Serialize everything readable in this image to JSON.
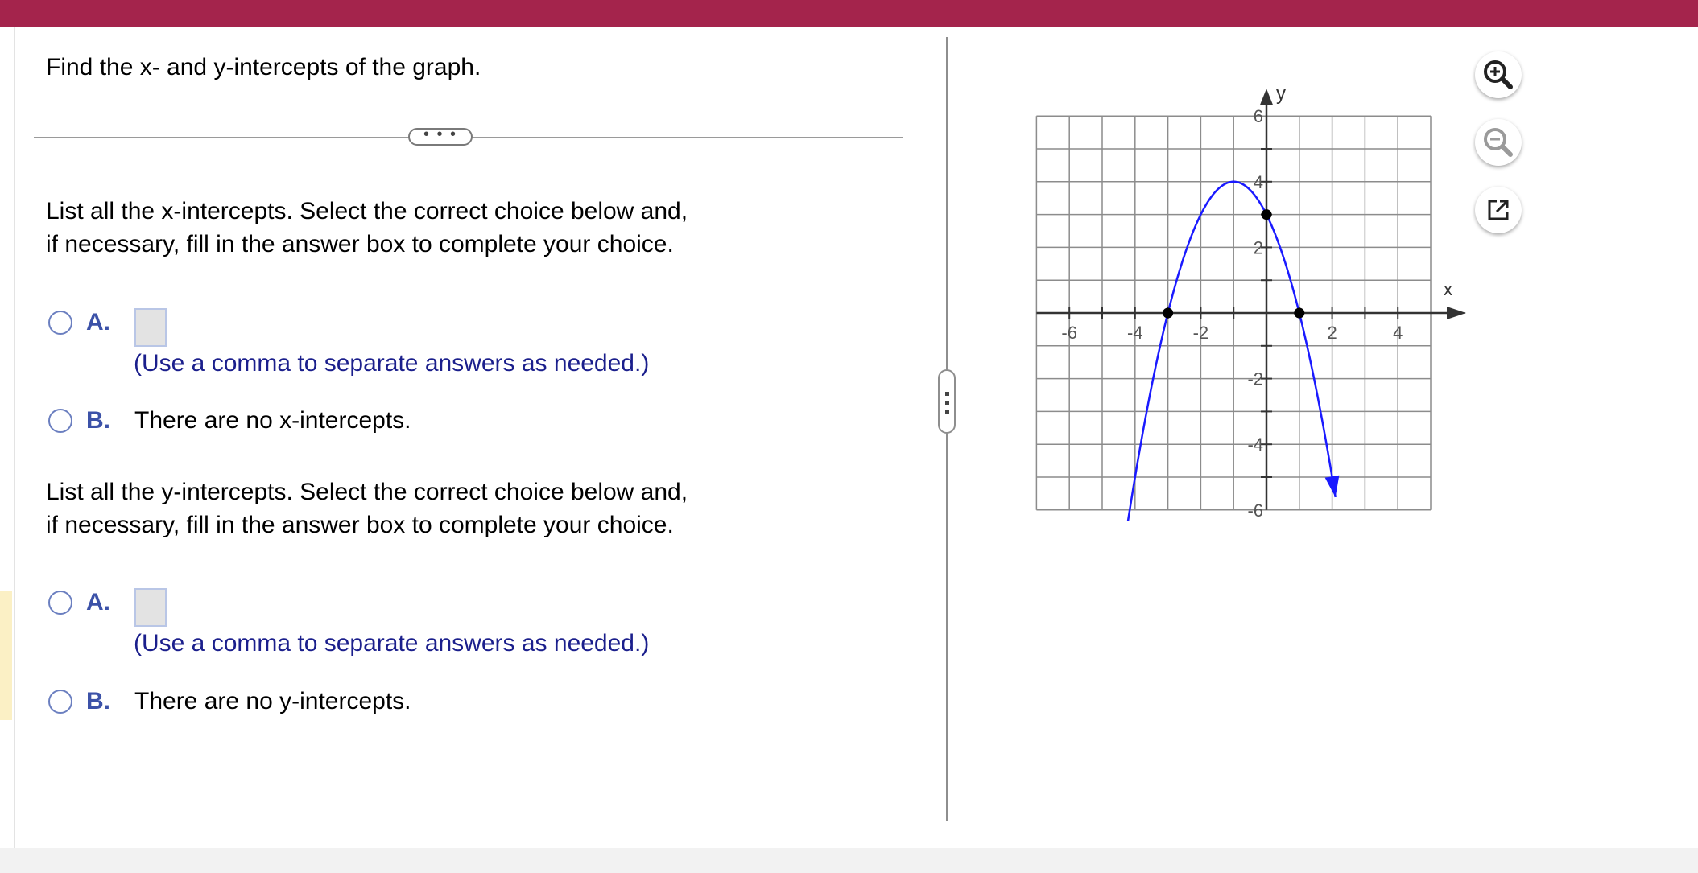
{
  "colors": {
    "header_bar": "#a4244c",
    "accent": "#3c52a8",
    "hint_text": "#1b1f8c",
    "curve": "#1a1aff"
  },
  "question": {
    "text": "Find the x- and y-intercepts of the graph.",
    "expand_label": "• • •"
  },
  "x_intercepts": {
    "instruction_line1": "List all the x-intercepts. Select the correct choice below and,",
    "instruction_line2": "if necessary, fill in the answer box to complete your choice.",
    "option_a": {
      "letter": "A.",
      "value": "",
      "hint": "(Use a comma to separate answers as needed.)"
    },
    "option_b": {
      "letter": "B.",
      "text": "There are no x-intercepts."
    }
  },
  "y_intercepts": {
    "instruction_line1": "List all the y-intercepts. Select the correct choice below and,",
    "instruction_line2": "if necessary, fill in the answer box to complete your choice.",
    "option_a": {
      "letter": "A.",
      "value": "",
      "hint": "(Use a comma to separate answers as needed.)"
    },
    "option_b": {
      "letter": "B.",
      "text": "There are no y-intercepts."
    }
  },
  "graph": {
    "x_axis_label": "x",
    "y_axis_label": "y",
    "x_tick_labels": [
      "-6",
      "-4",
      "-2",
      "2",
      "4"
    ],
    "y_tick_labels": [
      "6",
      "4",
      "2",
      "-2",
      "-4",
      "-6"
    ]
  },
  "tools": {
    "zoom_in_icon": "magnifier-plus-icon",
    "zoom_out_icon": "magnifier-minus-icon",
    "popout_icon": "external-link-icon"
  },
  "chart_data": {
    "type": "line",
    "title": "",
    "xlabel": "x",
    "ylabel": "y",
    "xlim": [
      -7,
      5
    ],
    "ylim": [
      -6,
      6
    ],
    "grid": true,
    "series": [
      {
        "function": "y = -(x + 3)(x - 1)",
        "x": [
          -4.6,
          -4,
          -3.5,
          -3,
          -2.5,
          -2,
          -1.5,
          -1,
          -0.5,
          0,
          0.5,
          1,
          1.5,
          2,
          2.1
        ],
        "y": [
          -5.76,
          -5,
          -2.25,
          0,
          1.75,
          3,
          3.75,
          4,
          3.75,
          3,
          1.75,
          0,
          -2.25,
          -5,
          -5.61
        ],
        "arrows_both_ends": true
      }
    ],
    "points": [
      {
        "x": -3,
        "y": 0
      },
      {
        "x": 1,
        "y": 0
      },
      {
        "x": 0,
        "y": 3
      }
    ]
  }
}
